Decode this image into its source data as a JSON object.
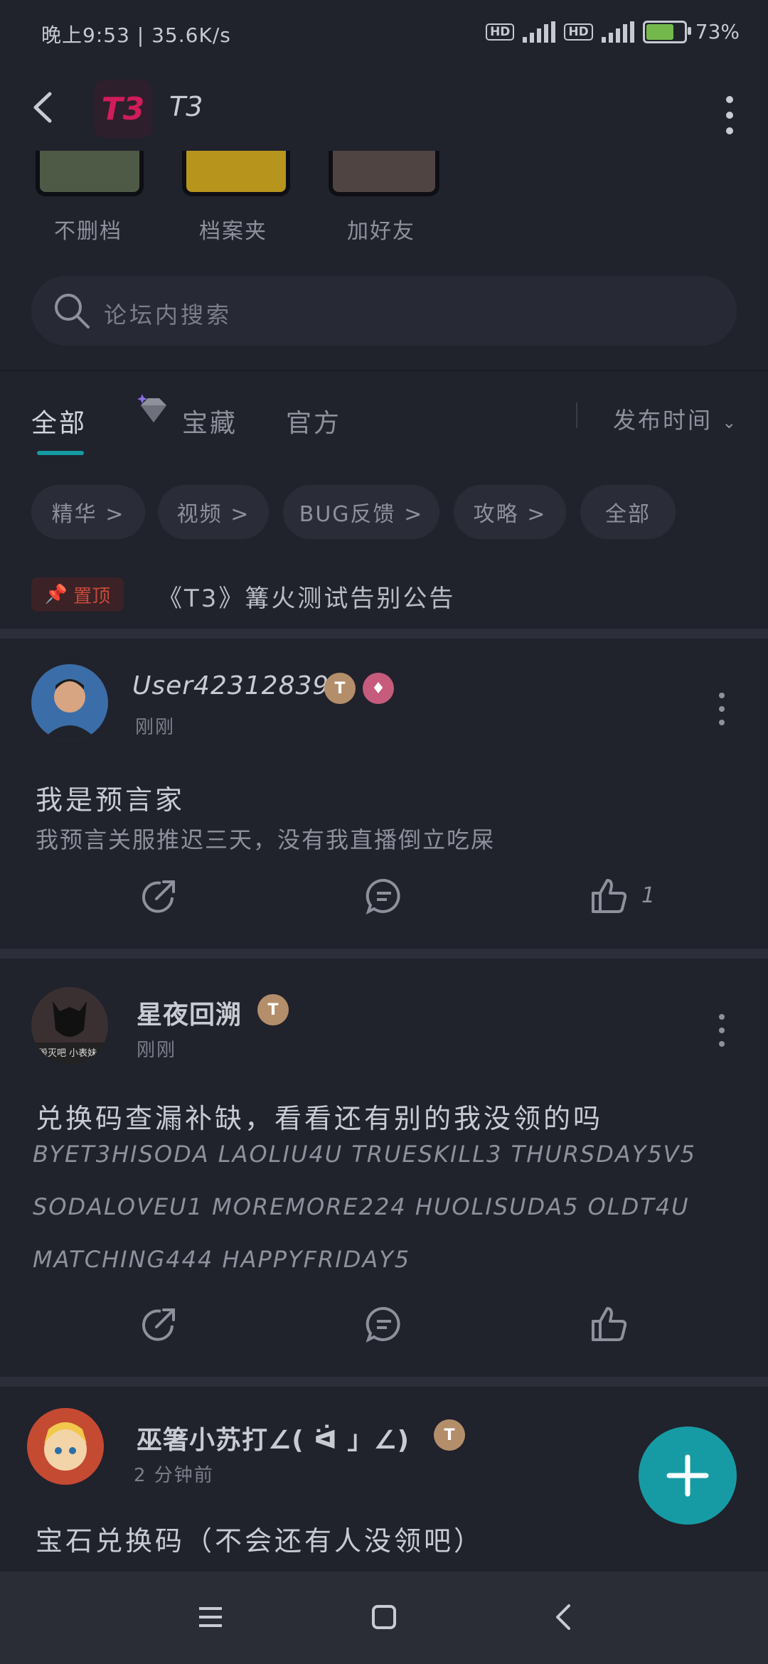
{
  "status_bar": {
    "time": "晚上9:53 | 35.6K/s",
    "hd1": "HD",
    "hd2": "HD",
    "battery": "73%"
  },
  "header": {
    "logo": "T3",
    "title": "T3"
  },
  "quick_links": [
    "不删档",
    "档案夹",
    "加好友"
  ],
  "search": {
    "placeholder": "论坛内搜索"
  },
  "tabs": [
    "全部",
    "宝藏",
    "官方"
  ],
  "sort": "发布时间",
  "chips": [
    "精华 >",
    "视频 >",
    "BUG反馈 >",
    "攻略 >",
    "全部"
  ],
  "pinned": {
    "badge": "置顶",
    "title": "《T3》篝火测试告别公告"
  },
  "posts": [
    {
      "user": "User423128394",
      "time": "刚刚",
      "title": "我是预言家",
      "body": "我预言关服推迟三天，没有我直播倒立吃屎",
      "likes": "1"
    },
    {
      "user": "星夜回溯",
      "time": "刚刚",
      "avatar_text": "毁灭吧 小表妹",
      "title": "兑换码查漏补缺，看看还有别的我没领的吗",
      "codes": [
        "BYET3HISODA LAOLIU4U TRUESKILL3 THURSDAY5V5",
        "SODALOVEU1 MOREMORE224 HUOLISUDA5 OLDT4U",
        "MATCHING444 HAPPYFRIDAY5"
      ]
    },
    {
      "user": "巫箸小苏打∠( ᐛ 」∠)",
      "time": "2 分钟前",
      "title": "宝石兑换码（不会还有人没领吧）"
    }
  ],
  "colors": {
    "accent": "#169ba4",
    "background": "#20222c",
    "logo": "#d01c5a"
  }
}
